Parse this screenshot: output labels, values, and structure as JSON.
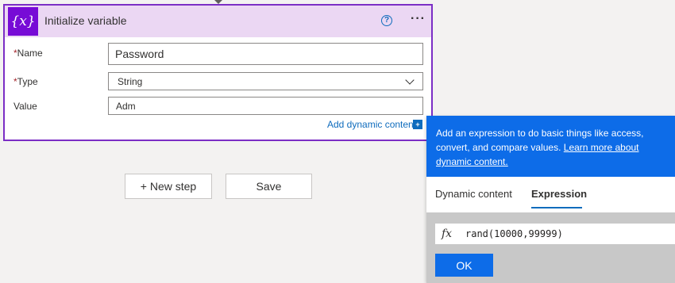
{
  "card": {
    "title": "Initialize variable",
    "icon_text": "{x}",
    "help_icon": "?",
    "more_icon": "···",
    "fields": {
      "name_label": "Name",
      "name_value": "Password",
      "type_label": "Type",
      "type_value": "String",
      "value_label": "Value",
      "value_value": "Adm",
      "required_mark": "*"
    },
    "dynamic_link": "Add dynamic content",
    "dynamic_icon": "+"
  },
  "buttons": {
    "new_step": "+ New step",
    "save": "Save"
  },
  "panel": {
    "info_text": "Add an expression to do basic things like access, convert, and compare values.",
    "info_link": "Learn more about dynamic content.",
    "tabs": {
      "dynamic": "Dynamic content",
      "expression": "Expression"
    },
    "fx_icon": "fx",
    "expression": "rand(10000,99999)",
    "ok": "OK"
  },
  "colors": {
    "accent": "#770bd6",
    "header_bg": "#ebd7f3",
    "link": "#0f6cbd",
    "info_bg": "#0d6ce8"
  }
}
